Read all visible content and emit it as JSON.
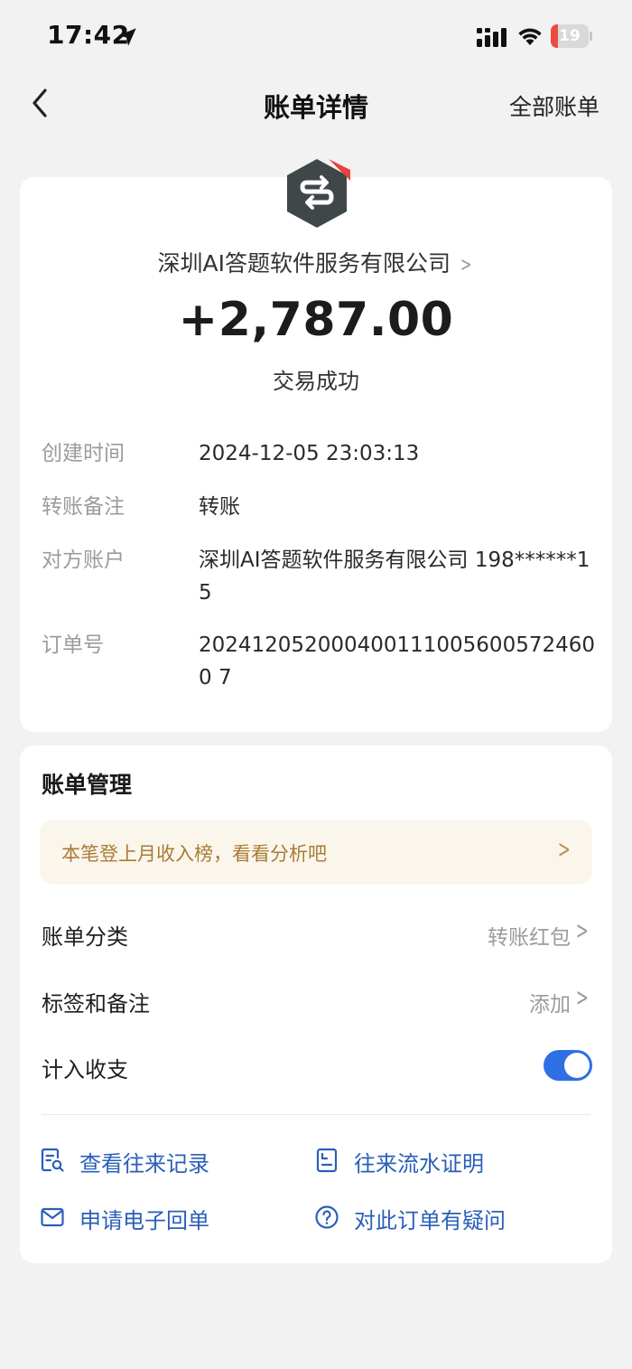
{
  "status_bar": {
    "time": "17:42",
    "battery_level": "19",
    "icons": [
      "location-arrow-icon",
      "signal-icon",
      "wifi-icon",
      "battery-icon"
    ]
  },
  "nav": {
    "back_icon": "chevron-left-icon",
    "title": "账单详情",
    "right_link": "全部账单"
  },
  "transaction": {
    "merchant_logo_icon": "merchant-logo-icon",
    "payee": "深圳AI答题软件服务有限公司",
    "amount": "+2,787.00",
    "status": "交易成功",
    "details": [
      {
        "label": "创建时间",
        "value": "2024-12-05 23:03:13"
      },
      {
        "label": "转账备注",
        "value": "转账"
      },
      {
        "label": "对方账户",
        "value": "深圳AI答题软件服务有限公司 198******15"
      },
      {
        "label": "订单号",
        "value": "2024120520004001110056005724600 7"
      }
    ]
  },
  "manage": {
    "title": "账单管理",
    "promo": "本笔登上月收入榜，看看分析吧",
    "rows": [
      {
        "label": "账单分类",
        "value": "转账红包"
      },
      {
        "label": "标签和备注",
        "value": "添加"
      },
      {
        "label": "计入收支",
        "toggle_on": true
      }
    ],
    "actions": [
      {
        "label": "查看往来记录",
        "icon": "record-search-icon"
      },
      {
        "label": "往来流水证明",
        "icon": "statement-doc-icon"
      },
      {
        "label": "申请电子回单",
        "icon": "mail-icon"
      },
      {
        "label": "对此订单有疑问",
        "icon": "question-circle-icon"
      }
    ]
  },
  "colors": {
    "accent_blue": "#2f6fe4",
    "link_blue": "#2a5fb8",
    "promo_text": "#a97b36",
    "promo_bg": "#fbf6ec",
    "logo_badge": "#e8433a"
  }
}
